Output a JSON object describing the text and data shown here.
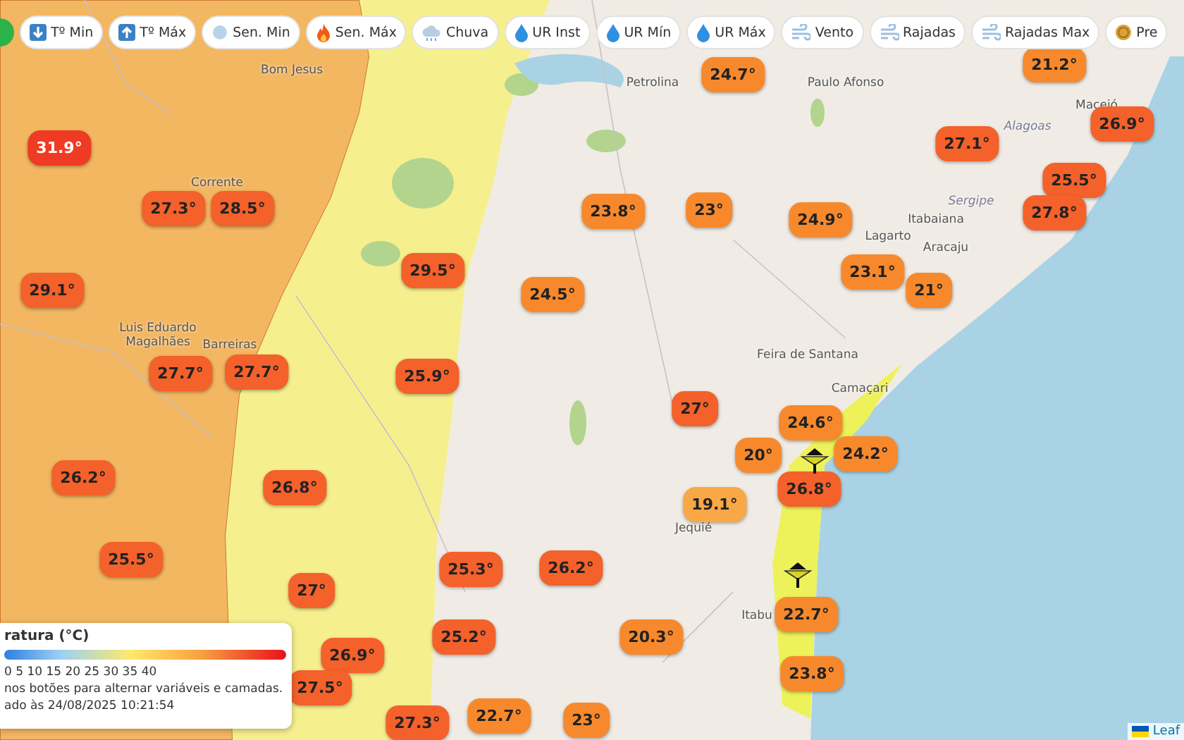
{
  "toolbar": {
    "buttons": [
      {
        "label": "Tº Min",
        "kind": "down"
      },
      {
        "label": "Tº Máx",
        "kind": "up"
      },
      {
        "label": "Sen. Min",
        "kind": "cold"
      },
      {
        "label": "Sen. Máx",
        "kind": "fire"
      },
      {
        "label": "Chuva",
        "kind": "rain"
      },
      {
        "label": "UR Inst",
        "kind": "drop"
      },
      {
        "label": "UR Mín",
        "kind": "drop"
      },
      {
        "label": "UR Máx",
        "kind": "drop"
      },
      {
        "label": "Vento",
        "kind": "wind"
      },
      {
        "label": "Rajadas",
        "kind": "wind"
      },
      {
        "label": "Rajadas Max",
        "kind": "wind"
      },
      {
        "label": "Pre",
        "kind": "coin"
      }
    ]
  },
  "map": {
    "place_labels": [
      {
        "text": "Bom Jesus",
        "kind": "city"
      },
      {
        "text": "Corrente",
        "kind": "city"
      },
      {
        "text": "Luis Eduardo Magalhães",
        "kind": "city"
      },
      {
        "text": "Barreiras",
        "kind": "city"
      },
      {
        "text": "Petrolina",
        "kind": "city"
      },
      {
        "text": "Paulo Afonso",
        "kind": "city"
      },
      {
        "text": "Alagoas",
        "kind": "state"
      },
      {
        "text": "Sergipe",
        "kind": "state"
      },
      {
        "text": "Itabaiana",
        "kind": "city"
      },
      {
        "text": "Lagarto",
        "kind": "city"
      },
      {
        "text": "Aracaju",
        "kind": "city"
      },
      {
        "text": "Maceió",
        "kind": "city"
      },
      {
        "text": "Feira de Santana",
        "kind": "city"
      },
      {
        "text": "Camaçari",
        "kind": "city"
      },
      {
        "text": "Jequié",
        "kind": "city"
      },
      {
        "text": "Itabu",
        "kind": "city"
      }
    ],
    "markers": [
      {
        "value": "31.9°",
        "color": "#ef3b24"
      },
      {
        "value": "27.3°",
        "color": "#f4612a"
      },
      {
        "value": "28.5°",
        "color": "#f4612a"
      },
      {
        "value": "29.1°",
        "color": "#f4612a"
      },
      {
        "value": "27.7°",
        "color": "#f4612a"
      },
      {
        "value": "27.7°",
        "color": "#f4612a"
      },
      {
        "value": "26.2°",
        "color": "#f4612a"
      },
      {
        "value": "26.8°",
        "color": "#f4612a"
      },
      {
        "value": "25.5°",
        "color": "#f4612a"
      },
      {
        "value": "27°",
        "color": "#f4612a"
      },
      {
        "value": "26.9°",
        "color": "#f4612a"
      },
      {
        "value": "27.5°",
        "color": "#f4612a"
      },
      {
        "value": "27.3°",
        "color": "#f4612a"
      },
      {
        "value": "29.5°",
        "color": "#f4612a"
      },
      {
        "value": "25.9°",
        "color": "#f4612a"
      },
      {
        "value": "24.5°",
        "color": "#f7892c"
      },
      {
        "value": "25.3°",
        "color": "#f4612a"
      },
      {
        "value": "26.2°",
        "color": "#f4612a"
      },
      {
        "value": "25.2°",
        "color": "#f4612a"
      },
      {
        "value": "22.7°",
        "color": "#f7892c"
      },
      {
        "value": "23°",
        "color": "#f7892c"
      },
      {
        "value": "20.3°",
        "color": "#f7892c"
      },
      {
        "value": "23.8°",
        "color": "#f7892c"
      },
      {
        "value": "23°",
        "color": "#f7892c"
      },
      {
        "value": "24.7°",
        "color": "#f7892c"
      },
      {
        "value": "24.9°",
        "color": "#f7892c"
      },
      {
        "value": "23.1°",
        "color": "#f7892c"
      },
      {
        "value": "21°",
        "color": "#f7892c"
      },
      {
        "value": "27.1°",
        "color": "#f4612a"
      },
      {
        "value": "21.2°",
        "color": "#f7892c"
      },
      {
        "value": "26.9°",
        "color": "#f4612a"
      },
      {
        "value": "25.5°",
        "color": "#f4612a"
      },
      {
        "value": "27.8°",
        "color": "#f4612a"
      },
      {
        "value": "27°",
        "color": "#f4612a"
      },
      {
        "value": "24.6°",
        "color": "#f7892c"
      },
      {
        "value": "20°",
        "color": "#f7892c"
      },
      {
        "value": "24.2°",
        "color": "#f7892c"
      },
      {
        "value": "26.8°",
        "color": "#f4612a"
      },
      {
        "value": "19.1°",
        "color": "#f9a847"
      },
      {
        "value": "22.7°",
        "color": "#f7892c"
      },
      {
        "value": "23.8°",
        "color": "#f7892c"
      }
    ],
    "attribution": "Leaf"
  },
  "legend": {
    "title": "ratura (°C)",
    "scale": "0 5 10 15 20 25 30 35 40",
    "hint": "nos botões para alternar variáveis e camadas.",
    "updated": "ado às 24/08/2025 10:21:54"
  }
}
